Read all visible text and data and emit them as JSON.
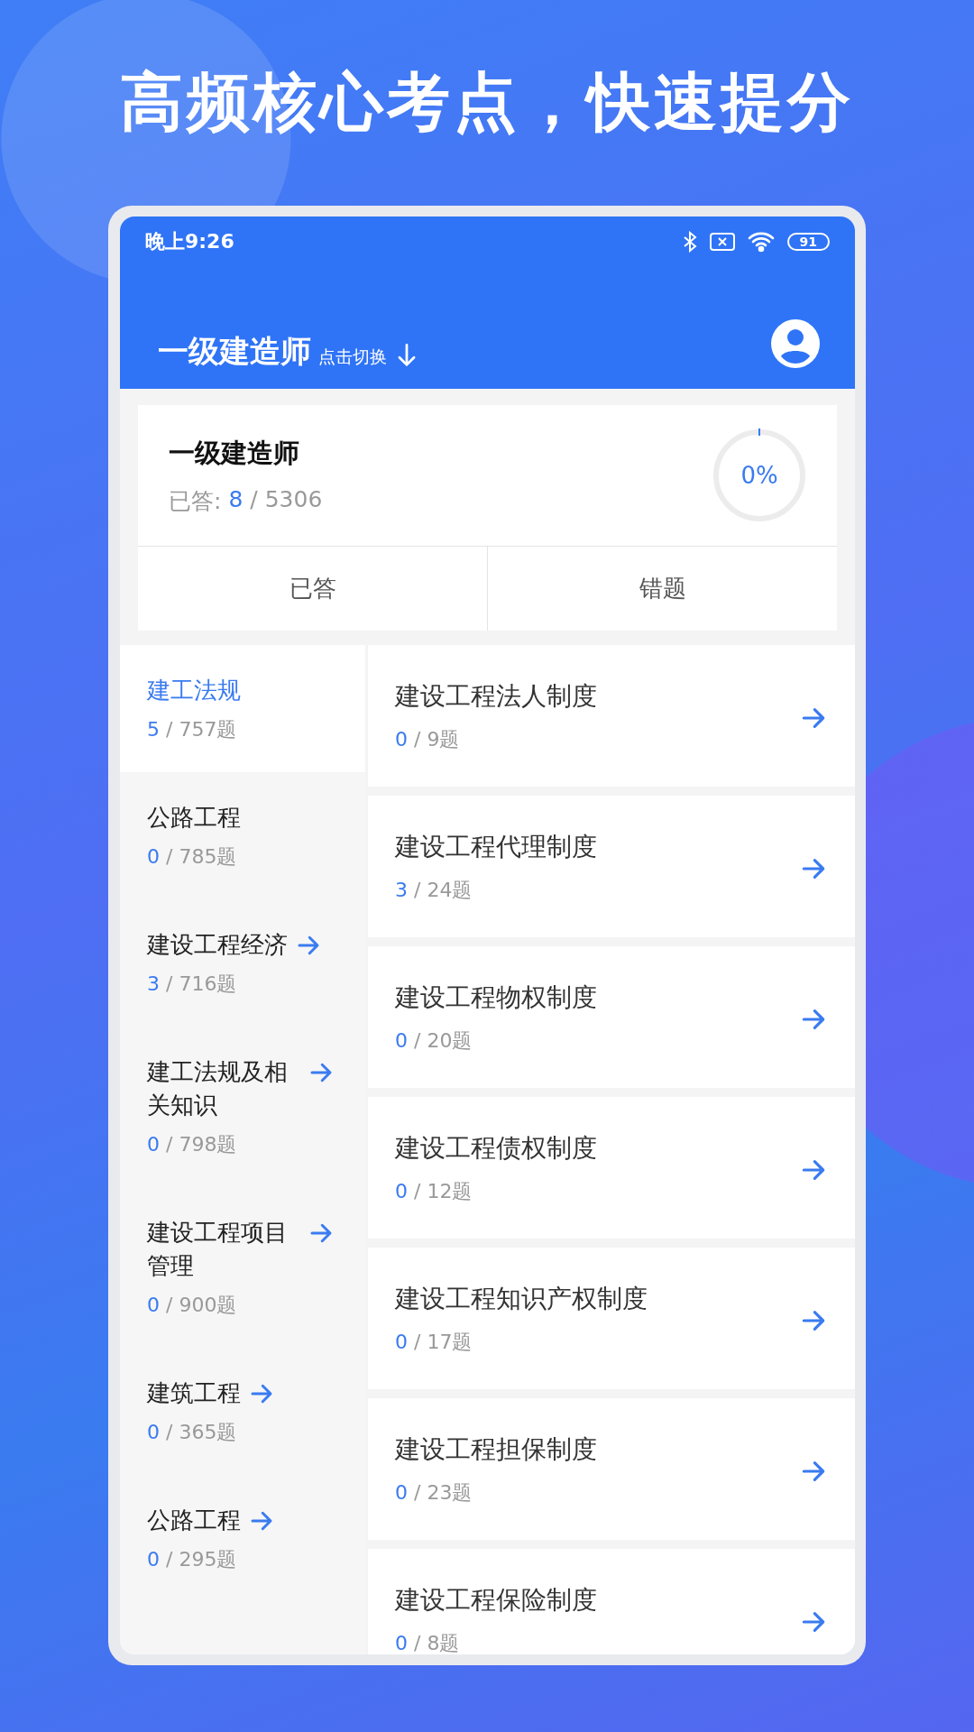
{
  "headline": "高频核心考点，快速提分",
  "status_bar": {
    "time": "晚上9:26",
    "battery": "91"
  },
  "header": {
    "title": "一级建造师",
    "switch_hint": "点击切换"
  },
  "summary": {
    "title": "一级建造师",
    "label": "已答:",
    "answered": "8",
    "total": "/ 5306",
    "progress": {
      "level": 0,
      "reading": "0%"
    },
    "buttons": [
      "已答",
      "错题"
    ]
  },
  "categories": [
    {
      "title": "建工法规",
      "done": "5",
      "total": "/ 757题",
      "selected": true,
      "arrow": false
    },
    {
      "title": "公路工程",
      "done": "0",
      "total": "/ 785题",
      "selected": false,
      "arrow": false
    },
    {
      "title": "建设工程经济",
      "done": "3",
      "total": "/ 716题",
      "selected": false,
      "arrow": true
    },
    {
      "title": "建工法规及相关知识",
      "done": "0",
      "total": "/ 798题",
      "selected": false,
      "arrow": true
    },
    {
      "title": "建设工程项目管理",
      "done": "0",
      "total": "/ 900题",
      "selected": false,
      "arrow": true
    },
    {
      "title": "建筑工程",
      "done": "0",
      "total": "/ 365题",
      "selected": false,
      "arrow": true
    },
    {
      "title": "公路工程",
      "done": "0",
      "total": "/ 295题",
      "selected": false,
      "arrow": true
    }
  ],
  "chapters": [
    {
      "title": "建设工程法人制度",
      "done": "0",
      "total": "/ 9题"
    },
    {
      "title": "建设工程代理制度",
      "done": "3",
      "total": "/ 24题"
    },
    {
      "title": "建设工程物权制度",
      "done": "0",
      "total": "/ 20题"
    },
    {
      "title": "建设工程债权制度",
      "done": "0",
      "total": "/ 12题"
    },
    {
      "title": "建设工程知识产权制度",
      "done": "0",
      "total": "/ 17题"
    },
    {
      "title": "建设工程担保制度",
      "done": "0",
      "total": "/ 23题"
    },
    {
      "title": "建设工程保险制度",
      "done": "0",
      "total": "/ 8题"
    }
  ]
}
